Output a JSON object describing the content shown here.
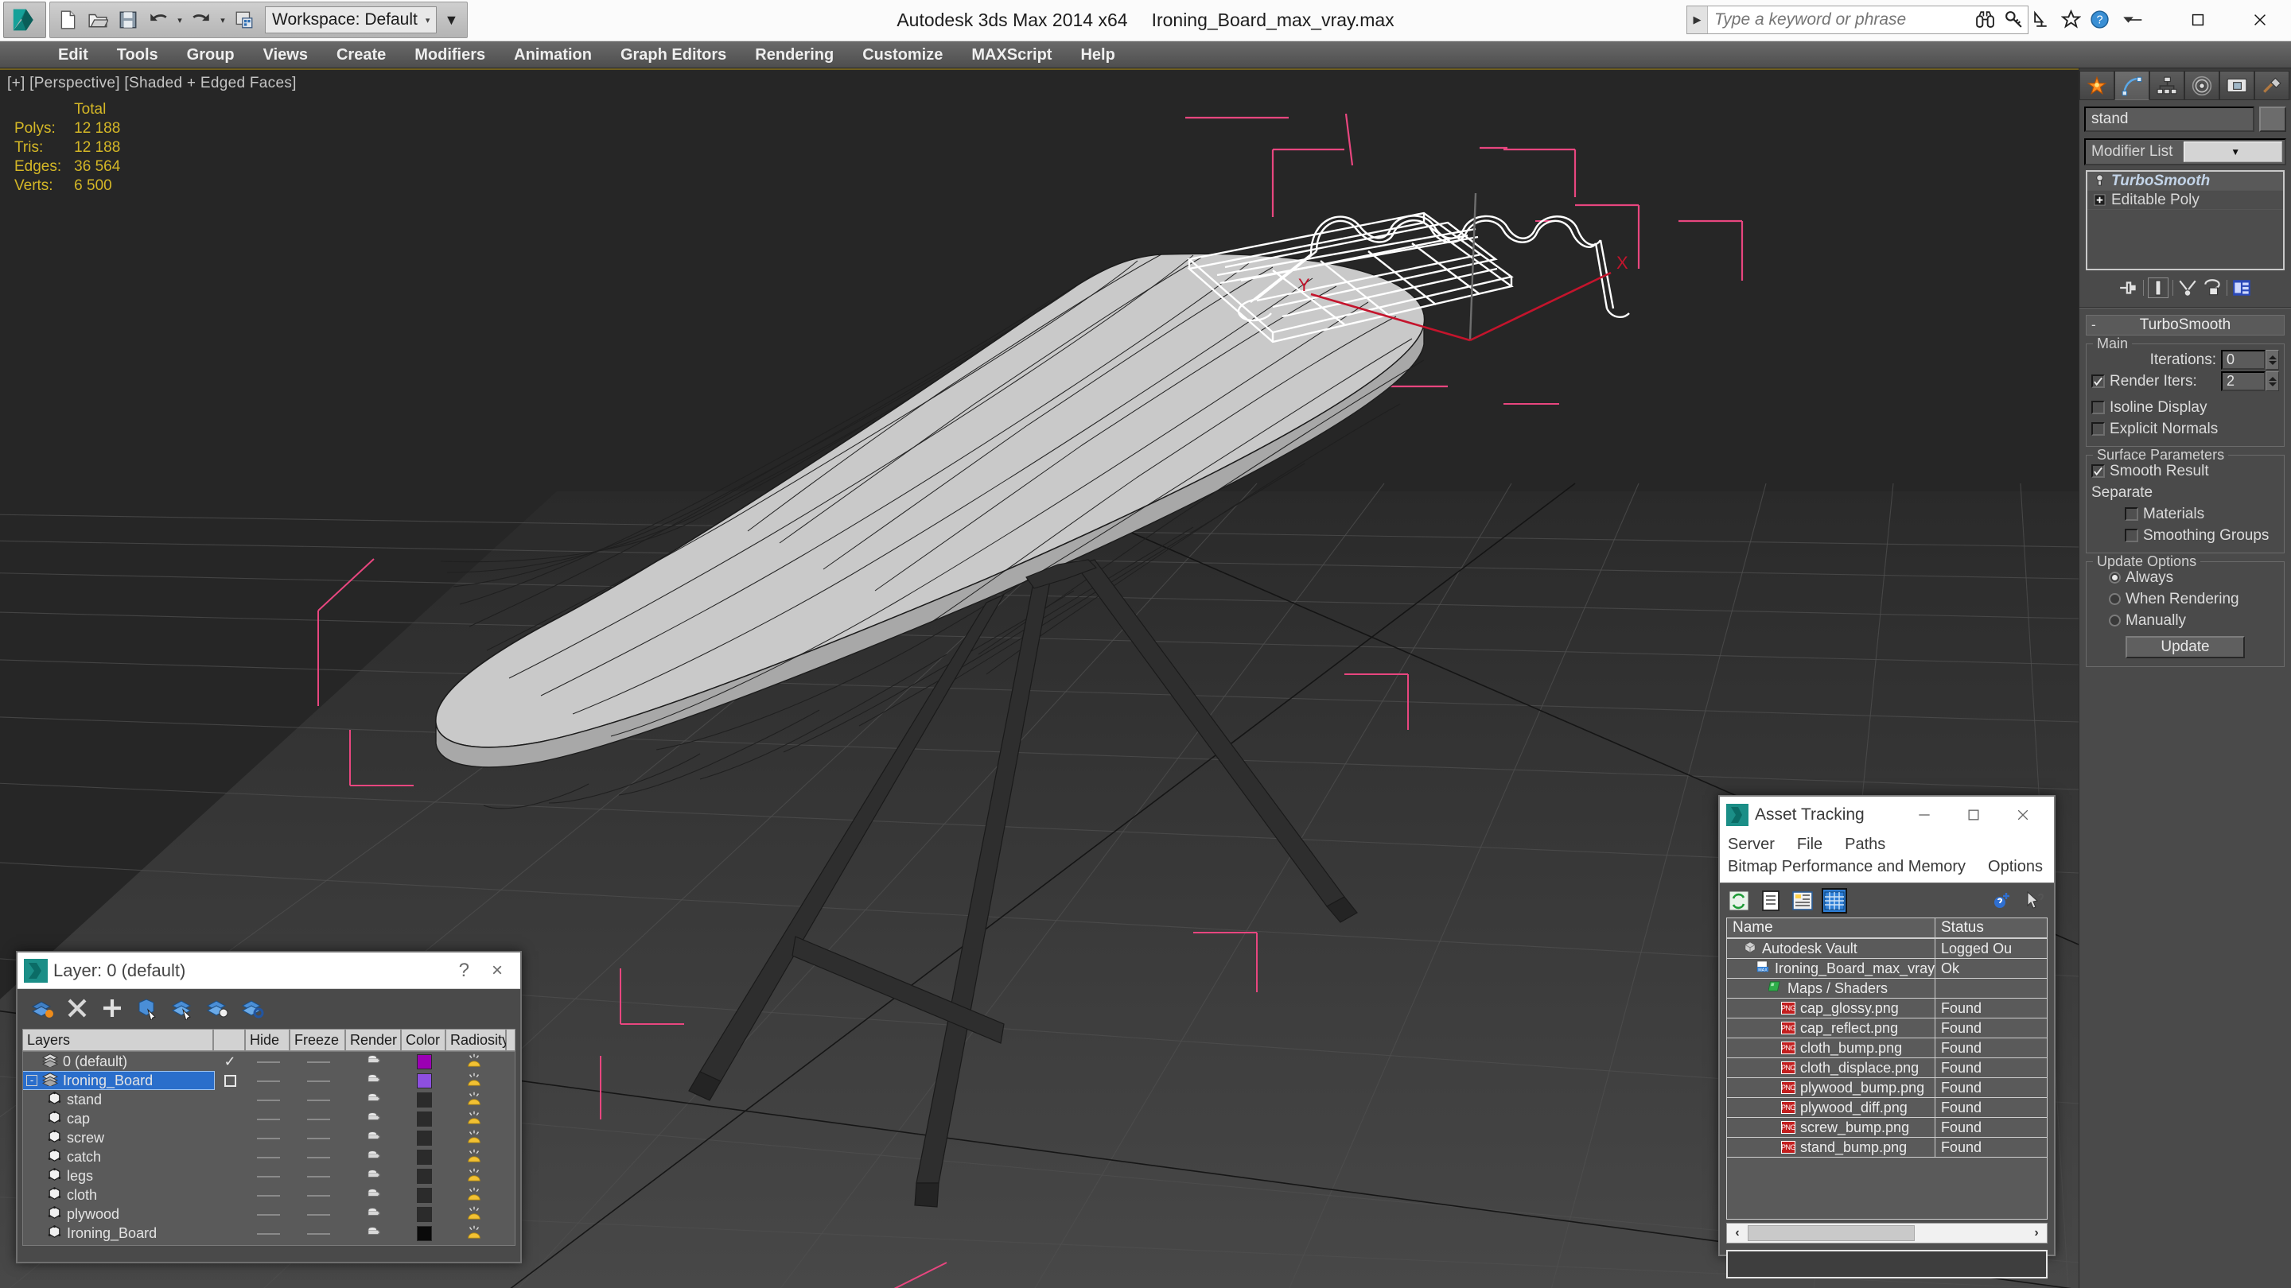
{
  "titlebar": {
    "app_title": "Autodesk 3ds Max  2014 x64",
    "file_name": "Ironing_Board_max_vray.max",
    "workspace": "Workspace: Default",
    "search_placeholder": "Type a keyword or phrase",
    "quick_access": [
      "new-icon",
      "open-icon",
      "save-icon",
      "undo-icon",
      "redo-icon",
      "project-folder-icon"
    ],
    "window_controls": [
      "minimize",
      "maximize",
      "close"
    ]
  },
  "menubar": {
    "items": [
      "Edit",
      "Tools",
      "Group",
      "Views",
      "Create",
      "Modifiers",
      "Animation",
      "Graph Editors",
      "Rendering",
      "Customize",
      "MAXScript",
      "Help"
    ]
  },
  "viewport": {
    "label": "[+] [Perspective] [Shaded + Edged Faces]",
    "stats": {
      "header": "Total",
      "rows": [
        {
          "label": "Polys:",
          "value": "12 188"
        },
        {
          "label": "Tris:",
          "value": "12 188"
        },
        {
          "label": "Edges:",
          "value": "36 564"
        },
        {
          "label": "Verts:",
          "value": "6 500"
        }
      ]
    },
    "axis_labels": {
      "x": "X",
      "y": "Y"
    },
    "colors": {
      "background": "#262626",
      "mesh": "#c9c9c9",
      "wire": "#1a1a1a",
      "selection": "#e8467f",
      "legs": "#303030",
      "grid": "#3a3a3a",
      "stats_text": "#d4b726"
    }
  },
  "command_panel": {
    "tabs": [
      "create-icon",
      "modify-icon",
      "hierarchy-icon",
      "motion-icon",
      "display-icon",
      "utilities-icon"
    ],
    "active_tab_index": 1,
    "object_name": "stand",
    "modifier_list_label": "Modifier List",
    "stack": [
      {
        "name": "TurboSmooth",
        "selected": true,
        "icon": "lightbulb-icon"
      },
      {
        "name": "Editable Poly",
        "selected": false,
        "icon": "plus-box-icon"
      }
    ],
    "stack_buttons": [
      "pin-stack-icon",
      "show-end-result-icon",
      "make-unique-icon",
      "remove-modifier-icon",
      "configure-sets-icon"
    ],
    "rollout": {
      "title": "TurboSmooth",
      "groups": [
        {
          "title": "Main",
          "iterations_label": "Iterations:",
          "iterations_value": "0",
          "render_iters_label": "Render Iters:",
          "render_iters_value": "2",
          "render_iters_checked": true,
          "isoline_label": "Isoline Display",
          "isoline_checked": false,
          "explicit_label": "Explicit Normals",
          "explicit_checked": false
        },
        {
          "title": "Surface Parameters",
          "smooth_result_label": "Smooth Result",
          "smooth_result_checked": true,
          "separate_label": "Separate",
          "materials_label": "Materials",
          "materials_checked": false,
          "smoothing_groups_label": "Smoothing Groups",
          "smoothing_groups_checked": false
        },
        {
          "title": "Update Options",
          "options": [
            {
              "label": "Always",
              "selected": true
            },
            {
              "label": "When Rendering",
              "selected": false
            },
            {
              "label": "Manually",
              "selected": false
            }
          ],
          "update_button": "Update"
        }
      ]
    }
  },
  "layer_dialog": {
    "title": "Layer: 0 (default)",
    "help_label": "?",
    "close_label": "×",
    "toolbar_icons": [
      "new-layer-icon",
      "delete-layer-icon",
      "add-layer-icon",
      "select-objects-icon",
      "select-highlighted-icon",
      "highlight-selected-icon",
      "layer-properties-icon"
    ],
    "columns": [
      "Layers",
      "",
      "Hide",
      "Freeze",
      "Render",
      "Color",
      "Radiosity",
      ""
    ],
    "rows": [
      {
        "name": "0 (default)",
        "indent": 0,
        "icon": "layer-icon",
        "expander": "",
        "check": "check",
        "hide": "—",
        "freeze": "—",
        "render": "teapot-icon",
        "color": "#9b00b4",
        "radiosity": "radiosity-icon",
        "selected": false
      },
      {
        "name": "Ironing_Board",
        "indent": 0,
        "icon": "layer-icon",
        "expander": "minus",
        "check": "box",
        "hide": "—",
        "freeze": "—",
        "render": "teapot-icon",
        "color": "#8e4fe0",
        "radiosity": "radiosity-icon",
        "selected": true
      },
      {
        "name": "stand",
        "indent": 1,
        "icon": "object-icon",
        "expander": "",
        "check": "",
        "hide": "—",
        "freeze": "—",
        "render": "teapot-icon",
        "color": "#2b2b2b",
        "radiosity": "radiosity-icon",
        "selected": false
      },
      {
        "name": "cap",
        "indent": 1,
        "icon": "object-icon",
        "expander": "",
        "check": "",
        "hide": "—",
        "freeze": "—",
        "render": "teapot-icon",
        "color": "#2b2b2b",
        "radiosity": "radiosity-icon",
        "selected": false
      },
      {
        "name": "screw",
        "indent": 1,
        "icon": "object-icon",
        "expander": "",
        "check": "",
        "hide": "—",
        "freeze": "—",
        "render": "teapot-icon",
        "color": "#2b2b2b",
        "radiosity": "radiosity-icon",
        "selected": false
      },
      {
        "name": "catch",
        "indent": 1,
        "icon": "object-icon",
        "expander": "",
        "check": "",
        "hide": "—",
        "freeze": "—",
        "render": "teapot-icon",
        "color": "#2b2b2b",
        "radiosity": "radiosity-icon",
        "selected": false
      },
      {
        "name": "legs",
        "indent": 1,
        "icon": "object-icon",
        "expander": "",
        "check": "",
        "hide": "—",
        "freeze": "—",
        "render": "teapot-icon",
        "color": "#2b2b2b",
        "radiosity": "radiosity-icon",
        "selected": false
      },
      {
        "name": "cloth",
        "indent": 1,
        "icon": "object-icon",
        "expander": "",
        "check": "",
        "hide": "—",
        "freeze": "—",
        "render": "teapot-icon",
        "color": "#2b2b2b",
        "radiosity": "radiosity-icon",
        "selected": false
      },
      {
        "name": "plywood",
        "indent": 1,
        "icon": "object-icon",
        "expander": "",
        "check": "",
        "hide": "—",
        "freeze": "—",
        "render": "teapot-icon",
        "color": "#2b2b2b",
        "radiosity": "radiosity-icon",
        "selected": false
      },
      {
        "name": "Ironing_Board",
        "indent": 1,
        "icon": "object-icon",
        "expander": "",
        "check": "",
        "hide": "—",
        "freeze": "—",
        "render": "teapot-icon",
        "color": "#0a0a0a",
        "radiosity": "radiosity-icon",
        "selected": false
      }
    ]
  },
  "asset_tracking": {
    "title": "Asset Tracking",
    "menus_row1": [
      "Server",
      "File",
      "Paths"
    ],
    "menus_row2": [
      "Bitmap Performance and Memory",
      "Options"
    ],
    "toolbar_icons": [
      "refresh-icon",
      "list-view-icon",
      "detail-view-icon",
      "grid-view-icon",
      "help-new-icon",
      "help-pointer-icon"
    ],
    "active_toolbar_index": 3,
    "columns": [
      "Name",
      "Status"
    ],
    "rows": [
      {
        "name": "Autodesk Vault",
        "status": "Logged Ou",
        "indent": 1,
        "icon": "vault-icon"
      },
      {
        "name": "Ironing_Board_max_vray.max",
        "status": "Ok",
        "indent": 2,
        "icon": "max-file-icon"
      },
      {
        "name": "Maps / Shaders",
        "status": "",
        "indent": 3,
        "icon": "maps-icon"
      },
      {
        "name": "cap_glossy.png",
        "status": "Found",
        "indent": 4,
        "icon": "png-icon"
      },
      {
        "name": "cap_reflect.png",
        "status": "Found",
        "indent": 4,
        "icon": "png-icon"
      },
      {
        "name": "cloth_bump.png",
        "status": "Found",
        "indent": 4,
        "icon": "png-icon"
      },
      {
        "name": "cloth_displace.png",
        "status": "Found",
        "indent": 4,
        "icon": "png-icon"
      },
      {
        "name": "plywood_bump.png",
        "status": "Found",
        "indent": 4,
        "icon": "png-icon"
      },
      {
        "name": "plywood_diff.png",
        "status": "Found",
        "indent": 4,
        "icon": "png-icon"
      },
      {
        "name": "screw_bump.png",
        "status": "Found",
        "indent": 4,
        "icon": "png-icon"
      },
      {
        "name": "stand_bump.png",
        "status": "Found",
        "indent": 4,
        "icon": "png-icon"
      }
    ],
    "scroll_left": "‹",
    "scroll_right": "›"
  }
}
